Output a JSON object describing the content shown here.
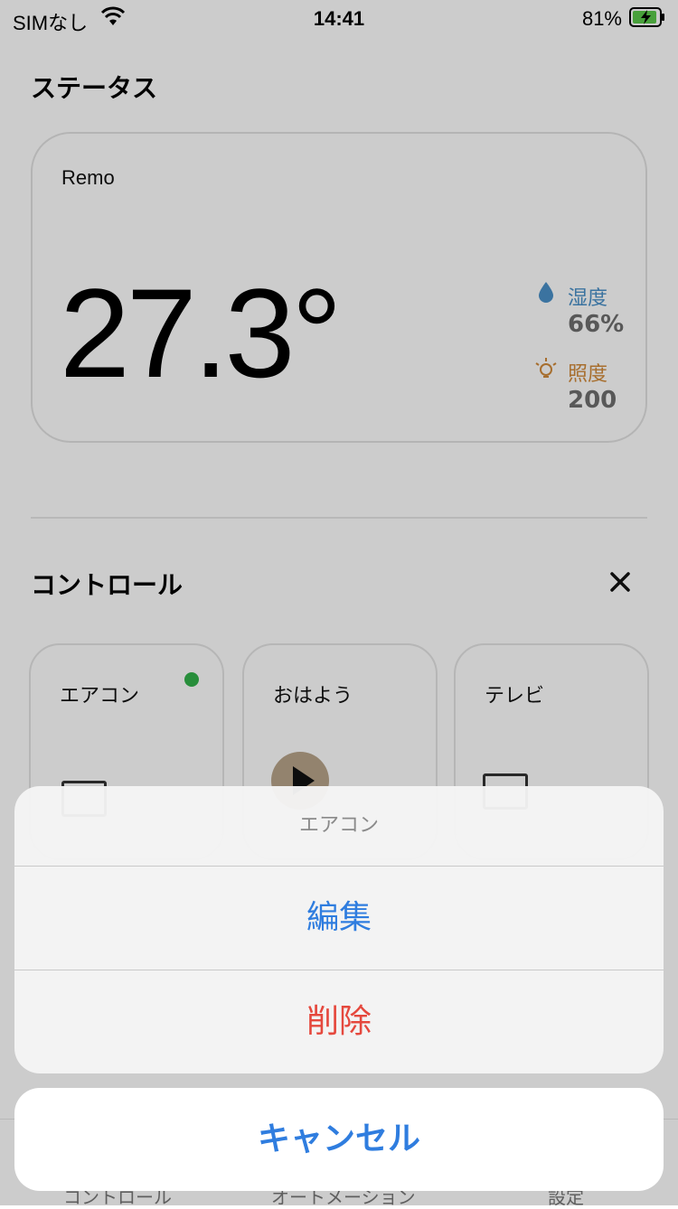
{
  "status_bar": {
    "carrier": "SIMなし",
    "time": "14:41",
    "battery": "81%"
  },
  "status_section": {
    "title": "ステータス",
    "device": "Remo",
    "temperature": "27.3°",
    "humidity_label": "湿度",
    "humidity_value": "66%",
    "illuminance_label": "照度",
    "illuminance_value": "200",
    "humidity_color": "#4a90c8",
    "illuminance_color": "#d18a3a"
  },
  "control_section": {
    "title": "コントロール",
    "tiles": [
      {
        "label": "エアコン"
      },
      {
        "label": "おはよう"
      },
      {
        "label": "テレビ"
      }
    ]
  },
  "tab_bar": {
    "tabs": [
      {
        "label": "コントロール"
      },
      {
        "label": "オートメーション"
      },
      {
        "label": "設定"
      }
    ]
  },
  "action_sheet": {
    "title": "エアコン",
    "edit": "編集",
    "delete": "削除",
    "cancel": "キャンセル",
    "accent_color": "#2f7ddf",
    "destructive_color": "#e5483d"
  }
}
